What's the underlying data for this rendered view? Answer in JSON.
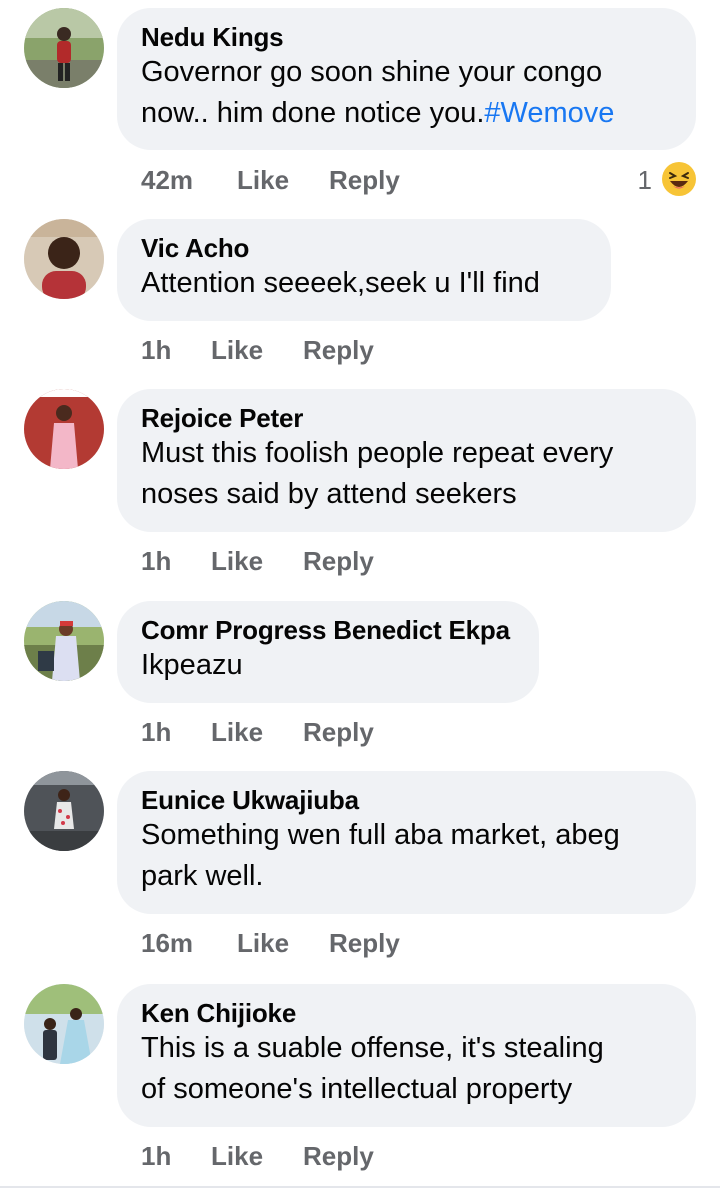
{
  "comments": [
    {
      "author": "Nedu Kings",
      "text": "Governor go soon shine your congo\nnow.. him done notice you.",
      "hashtag": "#Wemove",
      "time": "42m",
      "like": "Like",
      "reply": "Reply",
      "reaction_count": "1",
      "reaction_icon": "laughing-emoji-icon"
    },
    {
      "author": "Vic Acho",
      "text": "Attention seeeek,seek u I'll find",
      "time": "1h",
      "like": "Like",
      "reply": "Reply"
    },
    {
      "author": "Rejoice Peter",
      "text": "Must this foolish people repeat every\nnoses said by attend seekers",
      "time": "1h",
      "like": "Like",
      "reply": "Reply"
    },
    {
      "author": "Comr Progress Benedict Ekpa",
      "text": "Ikpeazu",
      "time": "1h",
      "like": "Like",
      "reply": "Reply"
    },
    {
      "author": "Eunice Ukwajiuba",
      "text": "Something wen full aba market, abeg\npark well.",
      "time": "16m",
      "like": "Like",
      "reply": "Reply"
    },
    {
      "author": "Ken Chijioke",
      "text": "This is a suable offense, it's stealing\nof someone's intellectual property",
      "time": "1h",
      "like": "Like",
      "reply": "Reply"
    }
  ],
  "colors": {
    "bubble": "#f0f2f5",
    "meta_text": "#65676b",
    "hashtag": "#1877f2",
    "emoji": "#f7c436"
  }
}
